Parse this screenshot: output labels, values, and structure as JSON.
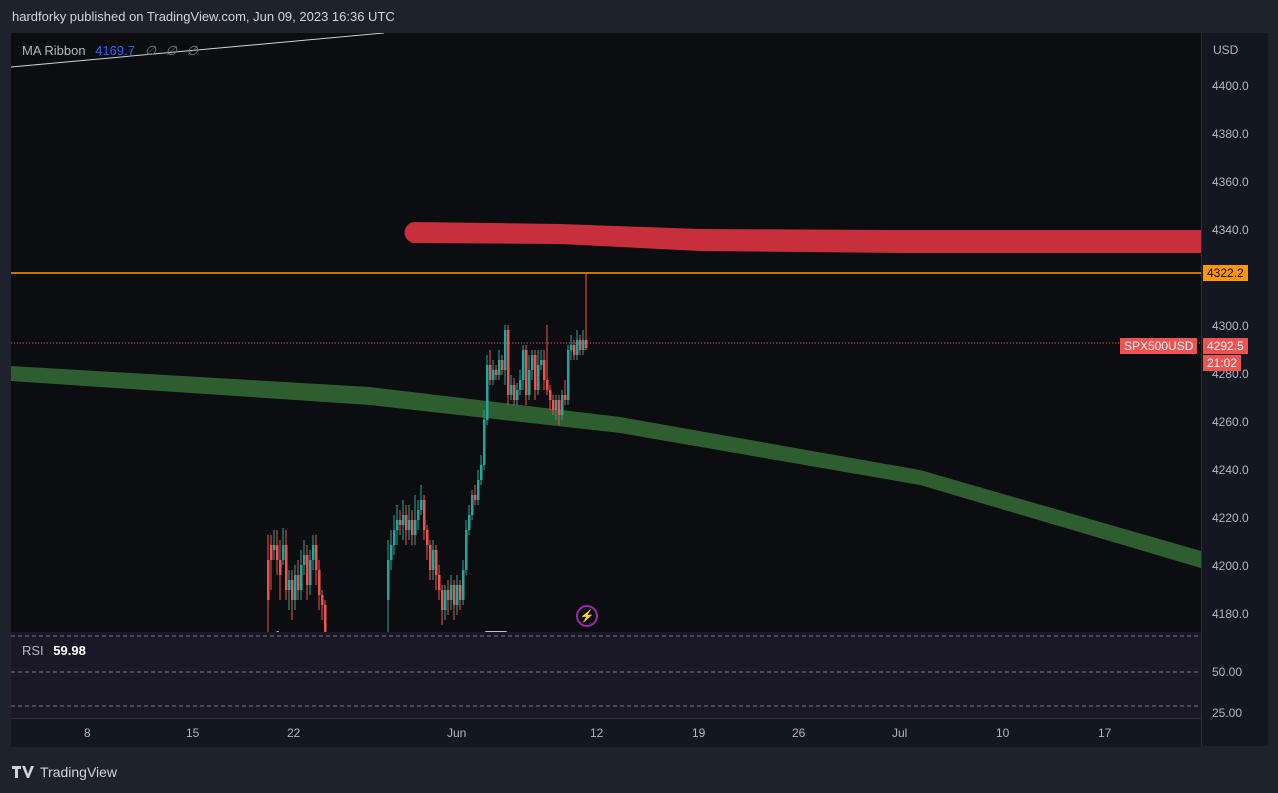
{
  "header": {
    "text": "hardforky published on TradingView.com, Jun 09, 2023 16:36 UTC"
  },
  "legend": {
    "name": "MA Ribbon",
    "value": "4169.7",
    "zeros": [
      "∅",
      "∅",
      "∅"
    ]
  },
  "rsi": {
    "label": "RSI",
    "value": "59.98",
    "levels": [
      "50.00",
      "25.00"
    ]
  },
  "price_axis": {
    "currency": "USD",
    "labels": [
      "4400.0",
      "4380.0",
      "4360.0",
      "4340.0",
      "4300.0",
      "4280.0",
      "4260.0",
      "4240.0",
      "4220.0",
      "4200.0",
      "4180.0"
    ]
  },
  "tags": {
    "resistance": "4322.2",
    "symbol": "SPX500USD",
    "last_price": "4292.5",
    "countdown": "21:02"
  },
  "time_axis": {
    "labels": [
      "8",
      "15",
      "22",
      "Jun",
      "12",
      "19",
      "26",
      "Jul",
      "10",
      "17"
    ]
  },
  "footer": {
    "brand": "TradingView"
  },
  "colors": {
    "up": "#26a69a",
    "down": "#ef5350",
    "red_band": "#c62f3b",
    "green_band": "#2e5e2f",
    "resistance": "#ff9800"
  },
  "chart_data": {
    "type": "candlestick",
    "symbol": "SPX500USD",
    "currency": "USD",
    "y_range": [
      4170,
      4410
    ],
    "resistance_level": 4322.2,
    "last_price": 4292.5,
    "ma_ribbon_value": 4169.7,
    "red_band": {
      "x": [
        "May 31",
        "Jun 12",
        "Jul 1",
        "Jul 24"
      ],
      "upper": [
        4344,
        4342,
        4340,
        4340
      ],
      "lower": [
        4336,
        4334,
        4332,
        4331
      ]
    },
    "green_band": {
      "x": [
        "May 1",
        "May 22",
        "Jun 5",
        "Jun 26",
        "Jul 24"
      ],
      "upper": [
        4287,
        4280,
        4270,
        4245,
        4210
      ],
      "lower": [
        4278,
        4270,
        4260,
        4232,
        4200
      ]
    },
    "rsi": {
      "label": "RSI",
      "value": 59.98,
      "levels": [
        50,
        25
      ]
    }
  }
}
